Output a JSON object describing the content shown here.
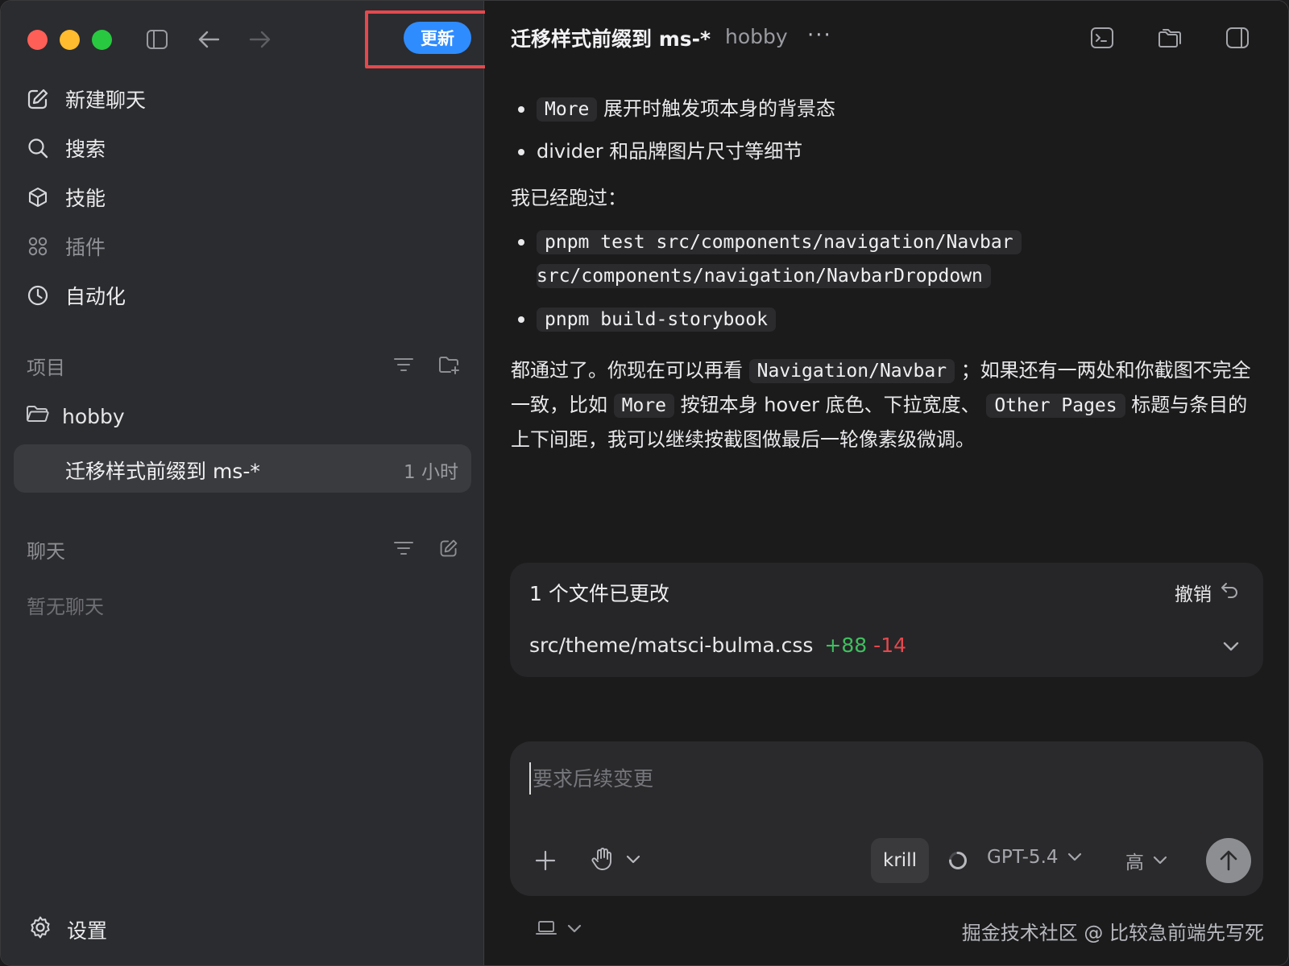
{
  "toolbar": {
    "update_label": "更新"
  },
  "sidebar": {
    "nav": [
      {
        "label": "新建聊天",
        "icon": "compose-icon"
      },
      {
        "label": "搜索",
        "icon": "search-icon"
      },
      {
        "label": "技能",
        "icon": "cube-icon"
      },
      {
        "label": "插件",
        "icon": "grid-icon"
      },
      {
        "label": "自动化",
        "icon": "clock-icon"
      }
    ],
    "projects_label": "项目",
    "project": {
      "name": "hobby"
    },
    "thread": {
      "title": "迁移样式前缀到 ms-*",
      "time": "1 小时"
    },
    "chats_label": "聊天",
    "chats_empty": "暂无聊天",
    "settings_label": "设置"
  },
  "header": {
    "title": "迁移样式前缀到 ms-*",
    "project": "hobby",
    "more": "···"
  },
  "content": {
    "b1_code": "More",
    "b1_text": "展开时触发项本身的背景态",
    "b2_text": "divider 和品牌图片尺寸等细节",
    "ran_label": "我已经跑过：",
    "cmd1_line1": "pnpm test src/components/navigation/Navbar",
    "cmd1_line2": "src/components/navigation/NavbarDropdown",
    "cmd2": "pnpm build-storybook",
    "p_a": "都通过了。你现在可以再看",
    "p_code1": "Navigation/Navbar",
    "p_b": "；如果还有一两处和你截图不完全一致，比如",
    "p_code2": "More",
    "p_c": "按钮本身 hover 底色、下拉宽度、",
    "p_code3": "Other Pages",
    "p_d": "标题与条目的上下间距，我可以继续按截图做最后一轮像素级微调。"
  },
  "changes": {
    "title": "1 个文件已更改",
    "undo_label": "撤销",
    "file": "src/theme/matsci-bulma.css",
    "additions": "+88",
    "deletions": "-14"
  },
  "composer": {
    "placeholder": "要求后续变更",
    "agent": "krill",
    "model": "GPT-5.4",
    "level": "高"
  },
  "footer": {
    "watermark": "掘金技术社区 @ 比较急前端先写死"
  },
  "colors": {
    "accent": "#2f8cff",
    "add": "#3fbf5f",
    "del": "#e5484d",
    "highlight": "#e5484d"
  }
}
